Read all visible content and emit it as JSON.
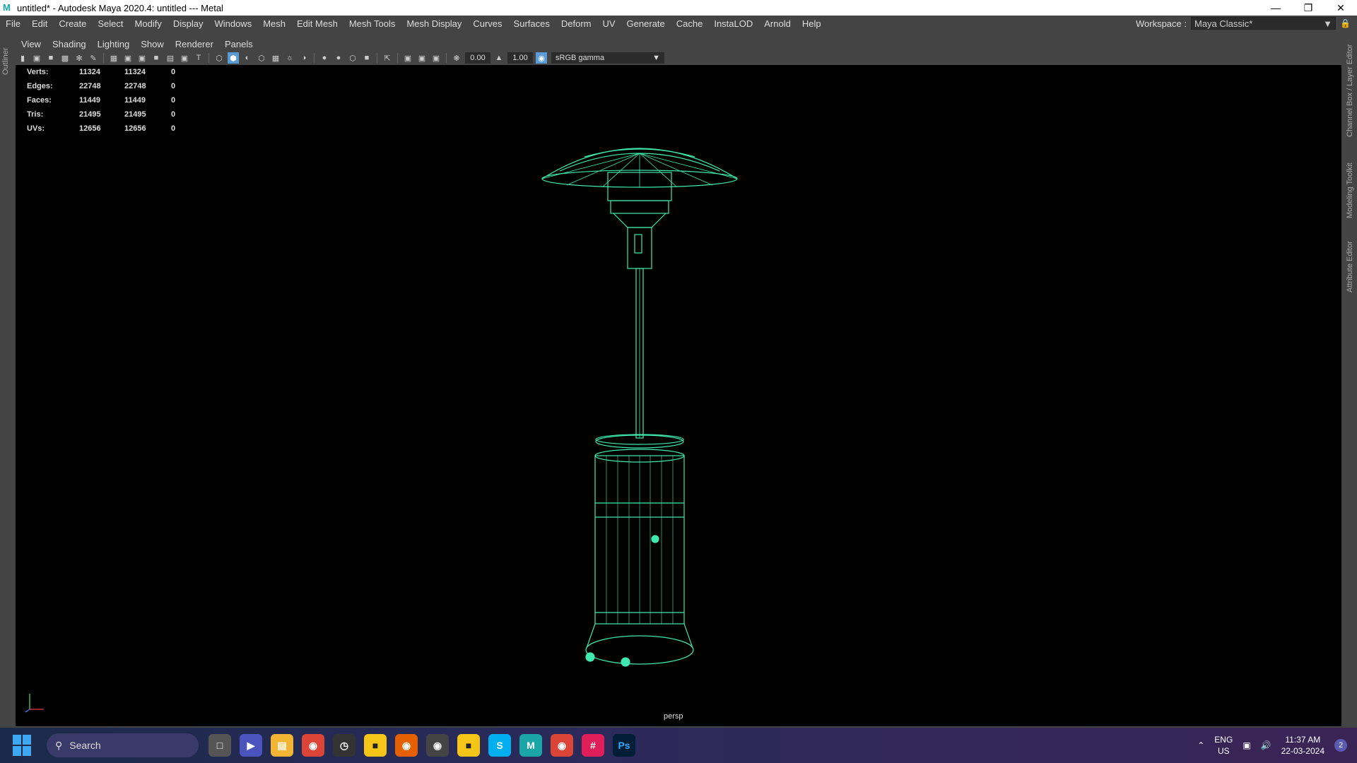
{
  "window": {
    "title": "untitled* - Autodesk Maya 2020.4: untitled   ---   Metal",
    "minimize_icon": "minimize-icon",
    "maximize_icon": "restore-icon",
    "close_icon": "close-icon"
  },
  "menubar": {
    "items": [
      "File",
      "Edit",
      "Create",
      "Select",
      "Modify",
      "Display",
      "Windows",
      "Mesh",
      "Edit Mesh",
      "Mesh Tools",
      "Mesh Display",
      "Curves",
      "Surfaces",
      "Deform",
      "UV",
      "Generate",
      "Cache",
      "InstaLOD",
      "Arnold",
      "Help"
    ],
    "workspace_label": "Workspace :",
    "workspace_value": "Maya Classic*"
  },
  "side_tabs": {
    "left": "Outliner",
    "right": [
      "Channel Box / Layer Editor",
      "Modeling Toolkit",
      "Attribute Editor"
    ]
  },
  "panel_menu": [
    "View",
    "Shading",
    "Lighting",
    "Show",
    "Renderer",
    "Panels"
  ],
  "panel_toolbar": {
    "exposure": "0.00",
    "gamma": "1.00",
    "color_space": "sRGB gamma"
  },
  "heads_up": {
    "rows": [
      {
        "label": "Verts:",
        "v1": "11324",
        "v2": "11324",
        "v3": "0"
      },
      {
        "label": "Edges:",
        "v1": "22748",
        "v2": "22748",
        "v3": "0"
      },
      {
        "label": "Faces:",
        "v1": "11449",
        "v2": "11449",
        "v3": "0"
      },
      {
        "label": "Tris:",
        "v1": "21495",
        "v2": "21495",
        "v3": "0"
      },
      {
        "label": "UVs:",
        "v1": "12656",
        "v2": "12656",
        "v3": "0"
      }
    ]
  },
  "viewport": {
    "camera": "persp",
    "wire_color": "#3fe8b0"
  },
  "taskbar": {
    "search_label": "Search",
    "lang": "ENG",
    "region": "US",
    "time": "11:37 AM",
    "date": "22-03-2024",
    "notifications": "2"
  }
}
